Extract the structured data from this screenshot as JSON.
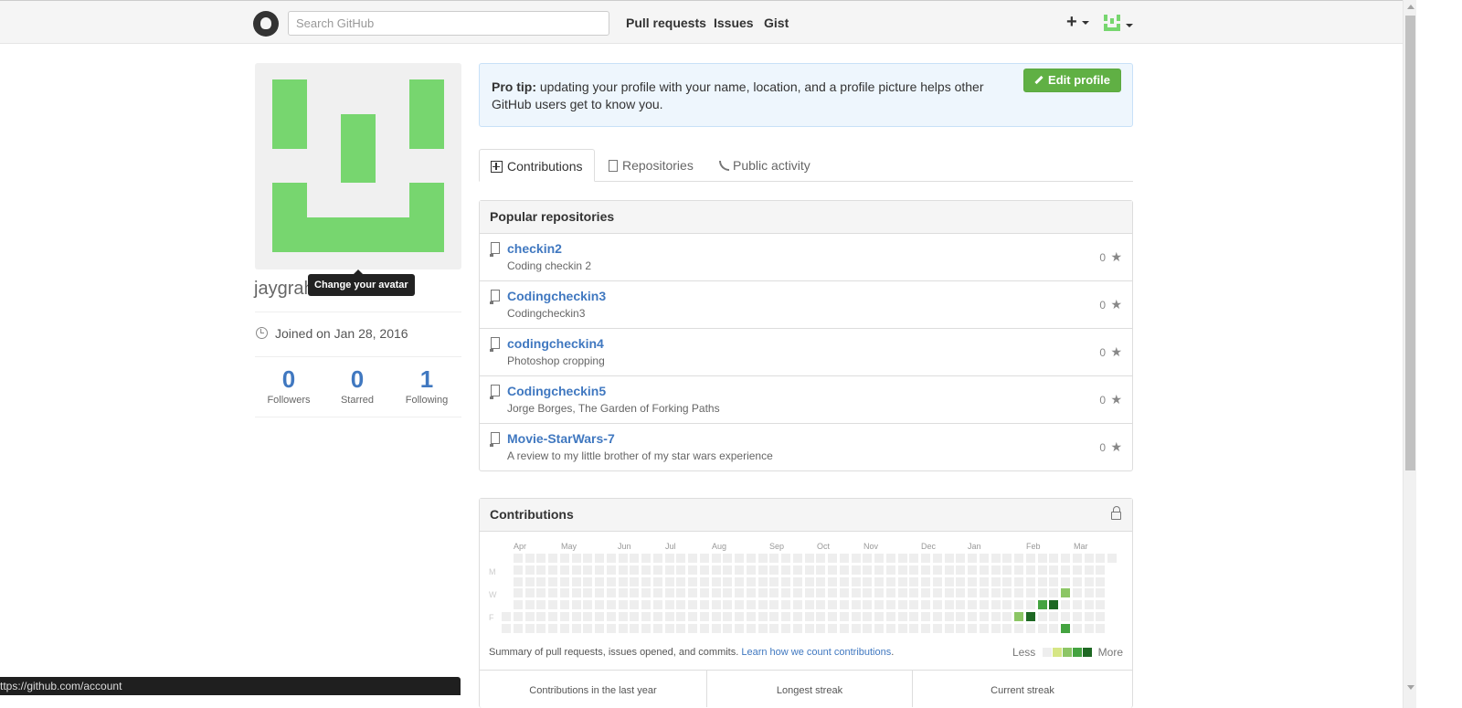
{
  "header": {
    "search_placeholder": "Search GitHub",
    "nav": [
      "Pull requests",
      "Issues",
      "Gist"
    ],
    "plus_label": "+"
  },
  "profile": {
    "tooltip": "Change your avatar",
    "username": "jaygraham",
    "joined": "Joined on Jan 28, 2016",
    "stats": [
      {
        "value": "0",
        "label": "Followers"
      },
      {
        "value": "0",
        "label": "Starred"
      },
      {
        "value": "1",
        "label": "Following"
      }
    ],
    "identicon_color": "#77d66f"
  },
  "protip": {
    "bold": "Pro tip:",
    "text": " updating your profile with your name, location, and a profile picture helps other GitHub users get to know you.",
    "edit_button": "Edit profile"
  },
  "tabs": [
    "Contributions",
    "Repositories",
    "Public activity"
  ],
  "popular": {
    "title": "Popular repositories",
    "repos": [
      {
        "name": "checkin2",
        "desc": "Coding checkin 2",
        "stars": "0"
      },
      {
        "name": "Codingcheckin3",
        "desc": "Codingcheckin3",
        "stars": "0"
      },
      {
        "name": "codingcheckin4",
        "desc": "Photoshop cropping",
        "stars": "0"
      },
      {
        "name": "Codingcheckin5",
        "desc": "Jorge Borges, The Garden of Forking Paths",
        "stars": "0"
      },
      {
        "name": "Movie-StarWars-7",
        "desc": "A review to my little brother of my star wars experience",
        "stars": "0"
      }
    ]
  },
  "contributions": {
    "title": "Contributions",
    "months": [
      "Apr",
      "May",
      "Jun",
      "Jul",
      "Aug",
      "Sep",
      "Oct",
      "Nov",
      "Dec",
      "Jan",
      "Feb",
      "Mar"
    ],
    "day_labels": [
      "M",
      "W",
      "F"
    ],
    "summary": "Summary of pull requests, issues opened, and commits.",
    "learn_link": "Learn how we count contributions",
    "legend_less": "Less",
    "legend_more": "More",
    "legend_colors": [
      "#eeeeee",
      "#d6e685",
      "#8cc665",
      "#44a340",
      "#1e6823"
    ],
    "stats": [
      "Contributions in the last year",
      "Longest streak",
      "Current streak"
    ],
    "active_cells": [
      {
        "week": 44,
        "day": 5,
        "level": 2
      },
      {
        "week": 45,
        "day": 5,
        "level": 4
      },
      {
        "week": 46,
        "day": 4,
        "level": 3
      },
      {
        "week": 47,
        "day": 4,
        "level": 4
      },
      {
        "week": 48,
        "day": 3,
        "level": 2
      },
      {
        "week": 48,
        "day": 6,
        "level": 3
      }
    ]
  },
  "statusbar": "ttps://github.com/account"
}
